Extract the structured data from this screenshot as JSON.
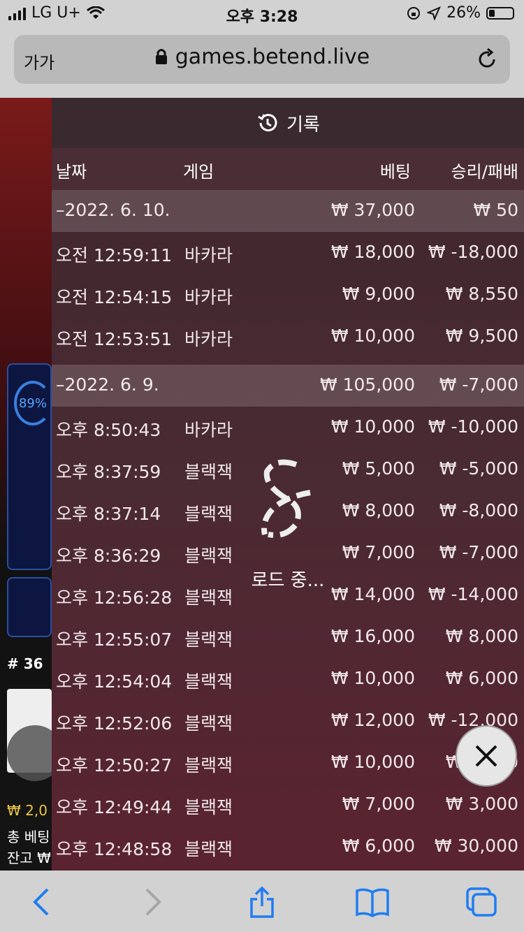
{
  "status_bar": {
    "carrier": "LG U+",
    "time": "오후 3:28",
    "battery_percent": "26%",
    "battery_level": 0.26
  },
  "browser": {
    "text_size_label": "가가",
    "domain": "games.betend.live"
  },
  "background": {
    "progress_label": "89%",
    "table_id": "# 36",
    "money_label": "₩ 2,0",
    "total_bet_label": "총 베팅",
    "balance_label": "잔고 ₩"
  },
  "panel": {
    "title": "기록",
    "columns": {
      "date": "날짜",
      "game": "게임",
      "bet": "베팅",
      "result": "승리/패배"
    },
    "rows": [
      {
        "type": "group",
        "date": "–2022. 6. 10.",
        "game": "",
        "bet": "₩ 37,000",
        "result": "₩ 50"
      },
      {
        "type": "item",
        "date": "오전 12:59:11",
        "game": "바카라",
        "bet": "₩ 18,000",
        "result": "₩ -18,000"
      },
      {
        "type": "item",
        "date": "오전 12:54:15",
        "game": "바카라",
        "bet": "₩ 9,000",
        "result": "₩ 8,550"
      },
      {
        "type": "item",
        "date": "오전 12:53:51",
        "game": "바카라",
        "bet": "₩ 10,000",
        "result": "₩ 9,500"
      },
      {
        "type": "group",
        "date": "–2022. 6. 9.",
        "game": "",
        "bet": "₩ 105,000",
        "result": "₩ -7,000"
      },
      {
        "type": "item",
        "date": "오후 8:50:43",
        "game": "바카라",
        "bet": "₩ 10,000",
        "result": "₩ -10,000"
      },
      {
        "type": "item",
        "date": "오후 8:37:59",
        "game": "블랙잭",
        "bet": "₩ 5,000",
        "result": "₩ -5,000"
      },
      {
        "type": "item",
        "date": "오후 8:37:14",
        "game": "블랙잭",
        "bet": "₩ 8,000",
        "result": "₩ -8,000"
      },
      {
        "type": "item",
        "date": "오후 8:36:29",
        "game": "블랙잭",
        "bet": "₩ 7,000",
        "result": "₩ -7,000"
      },
      {
        "type": "item",
        "date": "오후 12:56:28",
        "game": "블랙잭",
        "bet": "₩ 14,000",
        "result": "₩ -14,000"
      },
      {
        "type": "item",
        "date": "오후 12:55:07",
        "game": "블랙잭",
        "bet": "₩ 16,000",
        "result": "₩ 8,000"
      },
      {
        "type": "item",
        "date": "오후 12:54:04",
        "game": "블랙잭",
        "bet": "₩ 10,000",
        "result": "₩ 6,000"
      },
      {
        "type": "item",
        "date": "오후 12:52:06",
        "game": "블랙잭",
        "bet": "₩ 12,000",
        "result": "₩ -12,000"
      },
      {
        "type": "item",
        "date": "오후 12:50:27",
        "game": "블랙잭",
        "bet": "₩ 10,000",
        "result": "₩ 2,000"
      },
      {
        "type": "item",
        "date": "오후 12:49:44",
        "game": "블랙잭",
        "bet": "₩ 7,000",
        "result": "₩ 3,000"
      },
      {
        "type": "item",
        "date": "오후 12:48:58",
        "game": "블랙잭",
        "bet": "₩ 6,000",
        "result": "₩ 30,000"
      }
    ],
    "loading_text": "로드 중..."
  },
  "icons": {
    "history": "history-icon",
    "close": "close-icon",
    "lock": "lock-icon",
    "reload": "reload-icon",
    "back": "back-icon",
    "forward": "forward-icon",
    "share": "share-icon",
    "bookmarks": "bookmarks-icon",
    "tabs": "tabs-icon"
  },
  "colors": {
    "accent_blue": "#3a7fe0",
    "gold": "#e8c547"
  }
}
